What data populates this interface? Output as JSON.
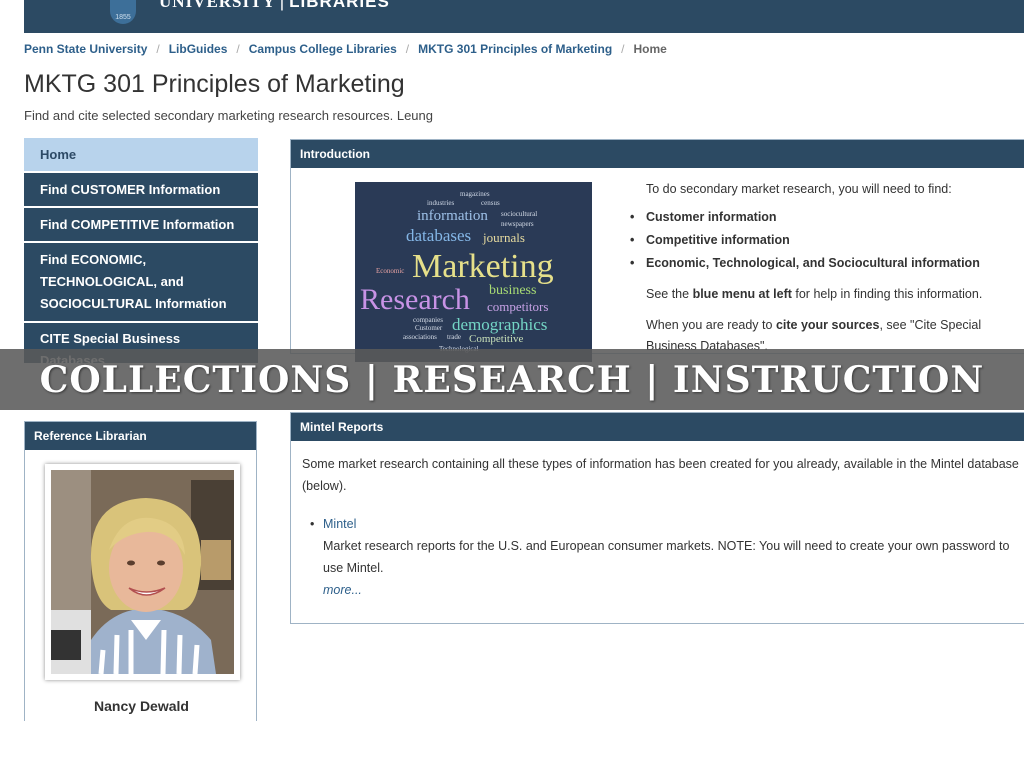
{
  "header": {
    "logo_year": "1855",
    "logo_university": "UNIVERSITY",
    "logo_separator": "|",
    "logo_libraries": "LIBRARIES",
    "bar_color": "#2c4a63"
  },
  "breadcrumb": {
    "items": [
      "Penn State University",
      "LibGuides",
      "Campus College Libraries",
      "MKTG 301 Principles of Marketing"
    ],
    "current": "Home",
    "separator": "/"
  },
  "page": {
    "title": "MKTG 301 Principles of Marketing",
    "description": "Find and cite selected secondary marketing research resources. Leung"
  },
  "nav": {
    "items": [
      {
        "label": "Home"
      },
      {
        "label": "Find CUSTOMER Information"
      },
      {
        "label": "Find COMPETITIVE Information"
      },
      {
        "label": "Find ECONOMIC, TECHNOLOGICAL, and SOCIOCULTURAL Information"
      },
      {
        "label": "CITE Special Business Databases"
      }
    ]
  },
  "intro": {
    "header": "Introduction",
    "lead": "To do secondary market research, you will need to find:",
    "list": [
      "Customer information",
      "Competitive information",
      "Economic, Technological, and Sociocultural information"
    ],
    "p2_prefix": "See the ",
    "p2_bold": "blue menu at left",
    "p2_suffix": " for help in finding this information.",
    "p3_prefix": "When you are ready to ",
    "p3_bold": "cite your sources",
    "p3_suffix": ", see \"Cite Special Business Databases\"."
  },
  "wordcloud": {
    "magazines": "magazines",
    "industries": "industries",
    "census": "census",
    "information": "information",
    "sociocultural": "sociocultural",
    "newspapers": "newspapers",
    "databases": "databases",
    "journals": "journals",
    "economic": "Economic",
    "marketing": "Marketing",
    "research": "Research",
    "business": "business",
    "competitors": "competitors",
    "companies": "companies",
    "customer": "Customer",
    "demographics": "demographics",
    "associations": "associations",
    "trade": "trade",
    "competitive": "Competitive",
    "technological": "Technological"
  },
  "banner": {
    "text": "COLLECTIONS | RESEARCH | INSTRUCTION"
  },
  "librarian": {
    "header": "Reference Librarian",
    "name": "Nancy Dewald"
  },
  "mintel": {
    "header": "Mintel Reports",
    "intro": "Some market research containing all these types of information has been created for you already, available in the Mintel database (below).",
    "link": "Mintel",
    "description": "Market research reports for the U.S. and European consumer markets. NOTE: You will need to create your own password to use Mintel.",
    "more": "more..."
  }
}
